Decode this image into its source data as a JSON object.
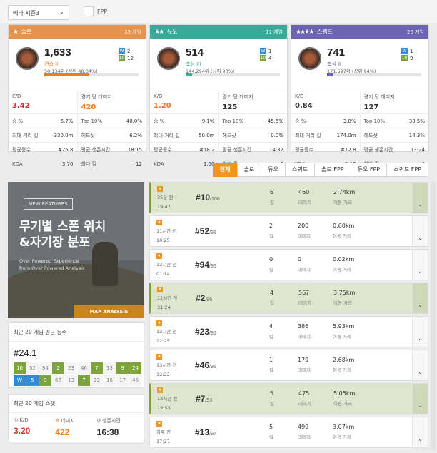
{
  "season": {
    "label": "베타 시즌3",
    "fpp_label": "FPP"
  },
  "cards": [
    {
      "mode": "솔로",
      "icon": "★",
      "games": "35 게임",
      "color": "#e8934c",
      "rating": "1,633",
      "tier": "견습 II",
      "tier_color": "#e67e22",
      "rank": "50,134위 (상위 48.04%)",
      "progress": 0.48,
      "bar_color": "#e67e22",
      "wins": "2",
      "top10": "12",
      "kd_label": "K/D",
      "kd": "3.42",
      "kd_color": "#c0392b",
      "dmg_label": "경기 당 데미지",
      "dmg": "420",
      "dmg_color": "#e67e22",
      "rows": [
        [
          "승 %",
          "5.7%",
          "Top 10%",
          "40.0%"
        ],
        [
          "최대 거리 킬",
          "330.0m",
          "헤드샷",
          "6.2%"
        ],
        [
          "평균등수",
          "#25.8",
          "평균 생존시간",
          "18:15"
        ],
        [
          "KDA",
          "3.70",
          "최다 킬",
          "12"
        ]
      ]
    },
    {
      "mode": "듀오",
      "icon": "★★",
      "games": "11 게임",
      "color": "#3ba99a",
      "rating": "514",
      "tier": "초심 III",
      "tier_color": "#3ba99a",
      "rank": "144,294위 (상위 93%)",
      "progress": 0.07,
      "bar_color": "#3ba99a",
      "wins": "1",
      "top10": "4",
      "kd_label": "K/D",
      "kd": "1.20",
      "kd_color": "#e67e22",
      "dmg_label": "경기 당 데미지",
      "dmg": "125",
      "dmg_color": "#333333",
      "rows": [
        [
          "승 %",
          "9.1%",
          "Top 10%",
          "45.5%"
        ],
        [
          "최대 거리 킬",
          "50.0m",
          "헤드샷",
          "0.0%"
        ],
        [
          "평균등수",
          "#18.2",
          "평균 생존시간",
          "14:32"
        ],
        [
          "KDA",
          "1.50",
          "최다 킬",
          "3"
        ]
      ]
    },
    {
      "mode": "스쿼드",
      "icon": "★★★★",
      "games": "26 게임",
      "color": "#6c63b5",
      "rating": "741",
      "tier": "초심 II",
      "tier_color": "#6c63b5",
      "rank": "171,597위 (상위 94%)",
      "progress": 0.06,
      "bar_color": "#6c63b5",
      "wins": "1",
      "top10": "9",
      "kd_label": "K/D",
      "kd": "0.84",
      "kd_color": "#333333",
      "dmg_label": "경기 당 데미지",
      "dmg": "127",
      "dmg_color": "#333333",
      "rows": [
        [
          "승 %",
          "3.8%",
          "Top 10%",
          "38.5%"
        ],
        [
          "최대 거리 킬",
          "174.0m",
          "헤드샷",
          "14.3%"
        ],
        [
          "평균등수",
          "#12.8",
          "평균 생존시간",
          "13:24"
        ],
        [
          "KDA",
          "1.16",
          "최다 킬",
          "6"
        ]
      ]
    }
  ],
  "tabs": [
    "전체",
    "솔로",
    "듀오",
    "스쿼드",
    "솔로 FPP",
    "듀오 FPP",
    "스쿼드 FPP"
  ],
  "ad": {
    "badge": "NEW FEATURES",
    "line1": "무기별 스폰 위치",
    "line2": "&자기장 분포",
    "sub1": "Over Powered Experience",
    "sub2": "from Over Powered Analysis",
    "cta": "MAP ANALYSIS"
  },
  "avg_rank": {
    "title": "최근 20 게임 평균 등수",
    "value": "#24.1",
    "grid": [
      [
        "10",
        "g"
      ],
      [
        "52",
        ""
      ],
      [
        "94",
        ""
      ],
      [
        "2",
        "g"
      ],
      [
        "23",
        ""
      ],
      [
        "46",
        ""
      ],
      [
        "7",
        "g"
      ],
      [
        "13",
        ""
      ],
      [
        "9",
        "g"
      ],
      [
        "24",
        "g"
      ],
      [
        "W",
        "w"
      ],
      [
        "5",
        "w"
      ],
      [
        "9",
        "g"
      ],
      [
        "66",
        ""
      ],
      [
        "13",
        ""
      ],
      [
        "7",
        "g"
      ],
      [
        "22",
        ""
      ],
      [
        "16",
        ""
      ],
      [
        "17",
        ""
      ],
      [
        "46",
        ""
      ]
    ]
  },
  "recent": {
    "title": "최근 20 게임 스탯",
    "kd_label": "K/D",
    "kd": "3.20",
    "dmg_label": "데미지",
    "dmg": "422",
    "surv_label": "생존시간",
    "surv": "16:38"
  },
  "matches": [
    {
      "ago": "35분 전",
      "time": "19:47",
      "place": "#10",
      "total": "/100",
      "kills": "6",
      "dmg": "460",
      "dist": "2.74km",
      "hl": true
    },
    {
      "ago": "11시간 전",
      "time": "10:25",
      "place": "#52",
      "total": "/95",
      "kills": "2",
      "dmg": "200",
      "dist": "0.60km",
      "hl": false
    },
    {
      "ago": "12시간 전",
      "time": "01:14",
      "place": "#94",
      "total": "/95",
      "kills": "0",
      "dmg": "0",
      "dist": "0.02km",
      "hl": false
    },
    {
      "ago": "12시간 전",
      "time": "31:24",
      "place": "#2",
      "total": "/96",
      "kills": "4",
      "dmg": "567",
      "dist": "3.75km",
      "hl": true
    },
    {
      "ago": "13시간 전",
      "time": "22:25",
      "place": "#23",
      "total": "/95",
      "kills": "4",
      "dmg": "386",
      "dist": "5.93km",
      "hl": false
    },
    {
      "ago": "13시간 전",
      "time": "12:22",
      "place": "#46",
      "total": "/95",
      "kills": "1",
      "dmg": "179",
      "dist": "2.68km",
      "hl": false
    },
    {
      "ago": "13시간 전",
      "time": "19:53",
      "place": "#7",
      "total": "/93",
      "kills": "5",
      "dmg": "475",
      "dist": "5.05km",
      "hl": true
    },
    {
      "ago": "하루 전",
      "time": "17:37",
      "place": "#13",
      "total": "/97",
      "kills": "5",
      "dmg": "499",
      "dist": "3.07km",
      "hl": false
    }
  ],
  "labels": {
    "kill": "킬",
    "damage": "데미지",
    "distance": "이동 거리"
  }
}
